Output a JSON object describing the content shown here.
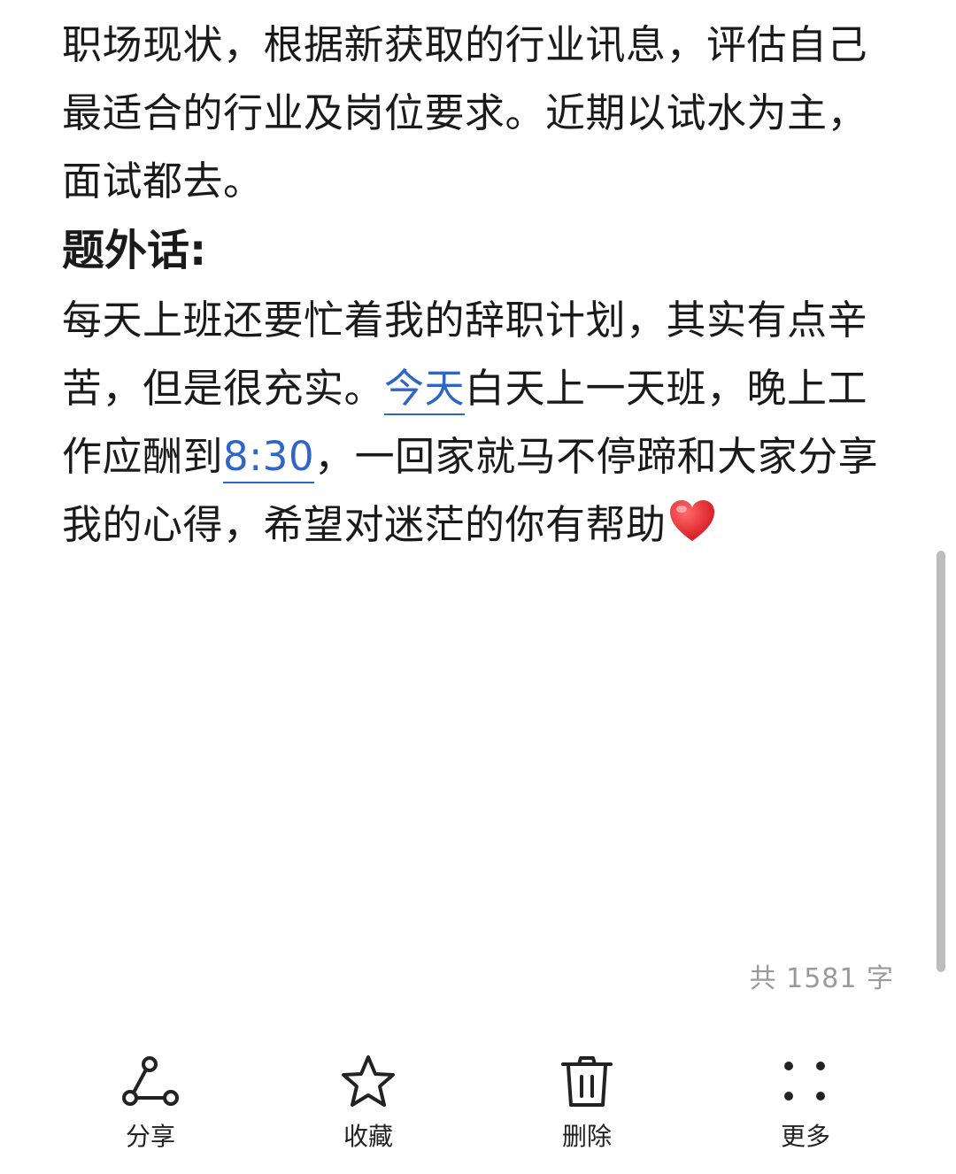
{
  "article": {
    "para1": "职场现状，根据新获取的行业讯息，评估自己最适合的行业及岗位要求。近期以试水为主，面试都去。",
    "heading": "题外话:",
    "para2_part1": "每天上班还要忙着我的辞职计划，其实有点辛苦，但是很充实。",
    "para2_link1": "今天",
    "para2_part2": "白天上一天班，晚上工作应酬到",
    "para2_link2": "8:30",
    "para2_part3": "，一回家就马不停蹄和大家分享我的心得，希望对迷茫的你有帮助",
    "heart_icon": "red-heart-emoji"
  },
  "footer": {
    "word_count": "共 1581 字"
  },
  "toolbar": {
    "share_label": "分享",
    "favorite_label": "收藏",
    "delete_label": "删除",
    "more_label": "更多"
  },
  "colors": {
    "link": "#2f64c9",
    "heart": "#e8202a",
    "muted_text": "#9a9a9a"
  }
}
